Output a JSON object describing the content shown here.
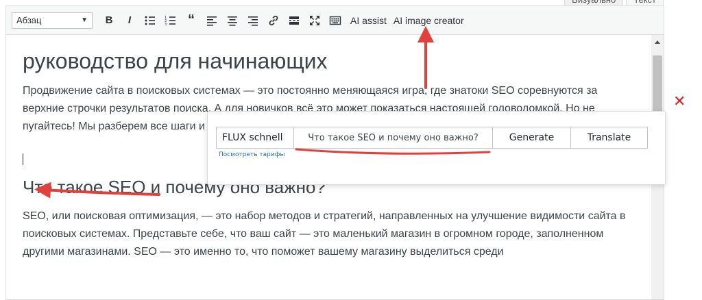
{
  "tabs": {
    "visual": "Визуально",
    "text": "Текст"
  },
  "toolbar": {
    "format_value": "Абзац",
    "bold": "B",
    "italic": "I",
    "quote": "“",
    "ai_assist": "AI assist",
    "ai_image_creator": "AI image creator"
  },
  "content": {
    "heading1": "руководство для начинающих",
    "intro": "Продвижение сайта в поисковых системах — это постоянно меняющаяся игра, где знатоки SEO соревнуются за верхние строчки результатов поиска. А для новичков всё это может показаться настоящей головоломкой. Но не пугайтесь! Мы разберем все шаги и выдаче. В этой статье мы рассмотр включая ключевые слова, контент,",
    "heading2": "Что такое SEO и почему оно важно?",
    "body": "SEO, или поисковая оптимизация, — это набор методов и стратегий, направленных на улучшение видимости сайта в поисковых системах. Представьте себе, что ваш сайт — это маленький магазин в огромном городе, заполненном другими магазинами. SEO — это именно то, что поможет вашему магазину выделиться среди"
  },
  "popup": {
    "model": "FLUX schnell",
    "prompt": "Что такое SEO и почему оно важно?",
    "generate": "Generate",
    "translate": "Translate",
    "pricing_link": "Посмотреть тарифы"
  },
  "close_symbol": "✕",
  "colors": {
    "annotation": "#e0413a",
    "link": "#2271b1",
    "close": "#e02020"
  }
}
